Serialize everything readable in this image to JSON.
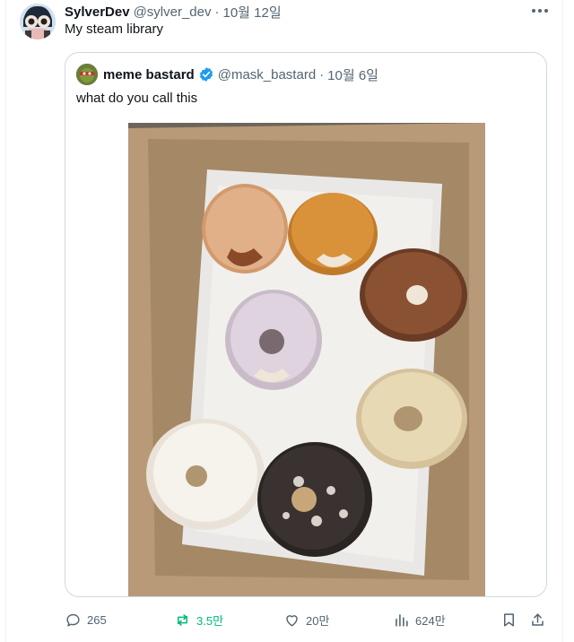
{
  "post": {
    "display_name": "SylverDev",
    "handle": "@sylver_dev",
    "separator": "·",
    "date": "10월 12일",
    "text": "My steam library"
  },
  "quoted": {
    "display_name": "meme bastard",
    "handle": "@mask_bastard",
    "separator": "·",
    "date": "10월 6일",
    "text": "what do you call this",
    "verified": true
  },
  "actions": {
    "replies": "265",
    "reposts": "3.5만",
    "likes": "20만",
    "views": "624만"
  },
  "colors": {
    "text": "#0f1419",
    "muted": "#536471",
    "repost_active": "#00ba7c",
    "verified": "#1d9bf0",
    "border": "#cfd9de"
  },
  "icons": [
    "more-icon",
    "verified-badge-icon",
    "reply-icon",
    "repost-icon",
    "like-icon",
    "views-icon",
    "bookmark-icon",
    "share-icon"
  ]
}
